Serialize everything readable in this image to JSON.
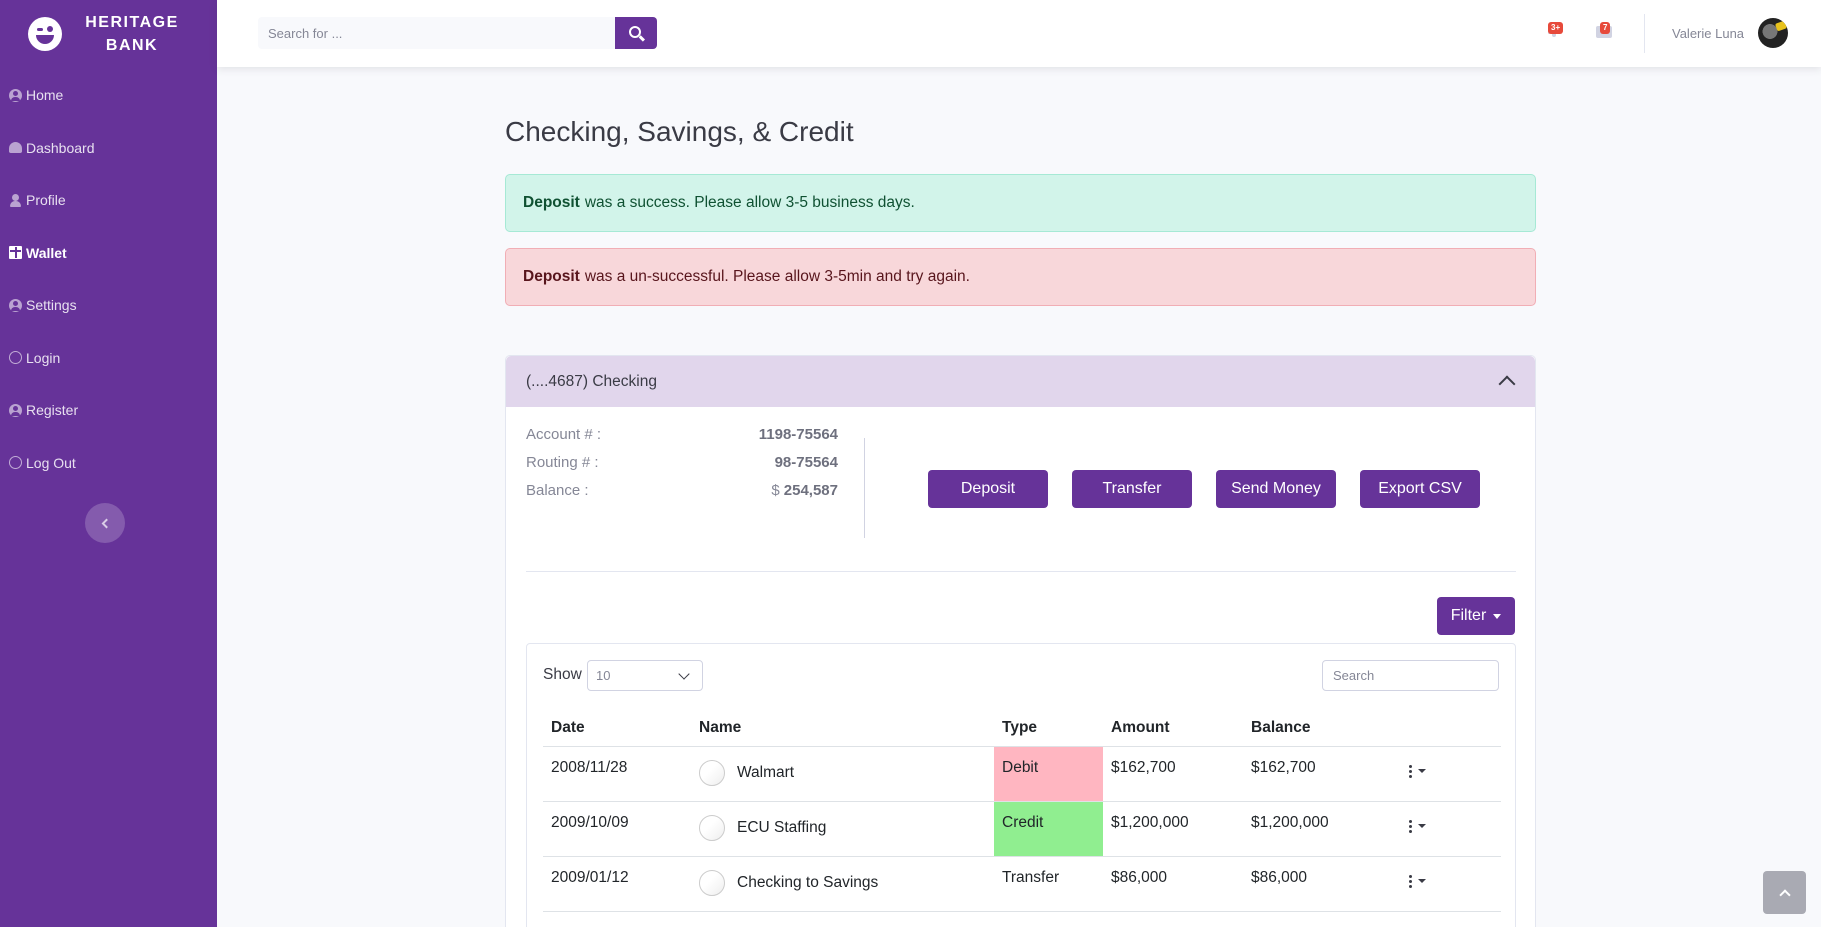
{
  "brand": {
    "name": "HERITAGE BANK"
  },
  "sidebar": {
    "items": [
      {
        "label": "Home",
        "icon": "user-circle-icon"
      },
      {
        "label": "Dashboard",
        "icon": "tachometer-icon"
      },
      {
        "label": "Profile",
        "icon": "user-icon"
      },
      {
        "label": "Wallet",
        "icon": "table-icon",
        "active": true
      },
      {
        "label": "Settings",
        "icon": "user-circle-icon"
      },
      {
        "label": "Login",
        "icon": "circle-user-outline-icon"
      },
      {
        "label": "Register",
        "icon": "user-circle-icon"
      },
      {
        "label": "Log Out",
        "icon": "circle-user-outline-icon"
      }
    ]
  },
  "topbar": {
    "search_placeholder": "Search for ...",
    "alerts_count": "3+",
    "messages_count": "7",
    "user_name": "Valerie Luna"
  },
  "page": {
    "title": "Checking, Savings, & Credit"
  },
  "alerts": {
    "success": {
      "strong": "Deposit",
      "text": "was a success. Please allow 3-5 business days."
    },
    "danger": {
      "strong": "Deposit",
      "text": "was a un-successful. Please allow 3-5min and try again."
    }
  },
  "account": {
    "header": "(....4687) Checking",
    "account_label": "Account # :",
    "account_value": "1198-75564",
    "routing_label": "Routing # :",
    "routing_value": "98-75564",
    "balance_label": "Balance :",
    "balance_currency": "$",
    "balance_value": "254,587",
    "actions": [
      "Deposit",
      "Transfer",
      "Send Money",
      "Export CSV"
    ],
    "filter_label": "Filter"
  },
  "table": {
    "show_label": "Show",
    "show_value": "10",
    "search_placeholder": "Search",
    "columns": [
      "Date",
      "Name",
      "Type",
      "Amount",
      "Balance"
    ],
    "rows": [
      {
        "date": "2008/11/28",
        "name": "Walmart",
        "type": "Debit",
        "amount": "$162,700",
        "balance": "$162,700"
      },
      {
        "date": "2009/10/09",
        "name": "ECU Staffing",
        "type": "Credit",
        "amount": "$1,200,000",
        "balance": "$1,200,000"
      },
      {
        "date": "2009/01/12",
        "name": "Checking to Savings",
        "type": "Transfer",
        "amount": "$86,000",
        "balance": "$86,000"
      }
    ]
  },
  "colors": {
    "primary": "#663399",
    "debit": "#ffb6c1",
    "credit": "#90ee90",
    "success_bg": "#d2f4ea",
    "danger_bg": "#f8d7da"
  }
}
